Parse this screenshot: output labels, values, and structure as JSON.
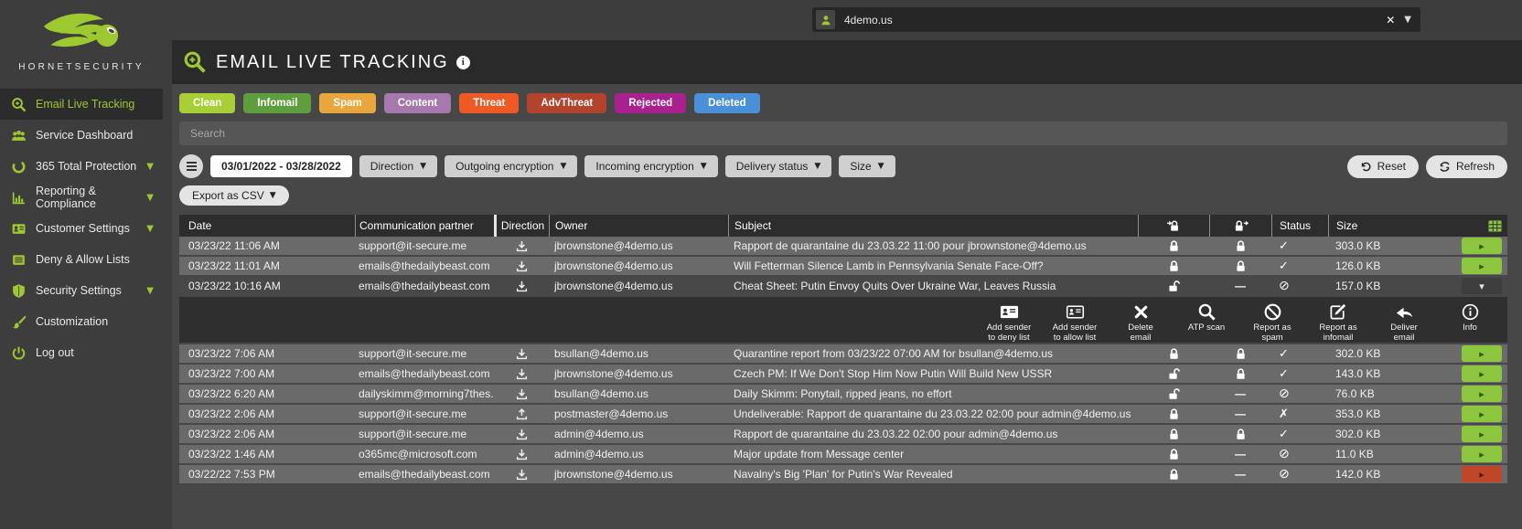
{
  "brand": {
    "name": "HORNETSECURITY"
  },
  "topbar": {
    "account": "4demo.us"
  },
  "header": {
    "title": "EMAIL LIVE TRACKING"
  },
  "sidebar": {
    "items": [
      {
        "label": "Email Live Tracking",
        "active": true
      },
      {
        "label": "Service Dashboard"
      },
      {
        "label": "365 Total Protection",
        "expandable": true
      },
      {
        "label": "Reporting & Compliance",
        "expandable": true
      },
      {
        "label": "Customer Settings",
        "expandable": true
      },
      {
        "label": "Deny & Allow Lists"
      },
      {
        "label": "Security Settings",
        "expandable": true
      },
      {
        "label": "Customization"
      },
      {
        "label": "Log out"
      }
    ]
  },
  "chips": [
    {
      "label": "Clean",
      "color": "#a8cf36"
    },
    {
      "label": "Infomail",
      "color": "#5f9e3e"
    },
    {
      "label": "Spam",
      "color": "#e9a63c"
    },
    {
      "label": "Content",
      "color": "#a678ad"
    },
    {
      "label": "Threat",
      "color": "#ef5a24"
    },
    {
      "label": "AdvThreat",
      "color": "#b2432c"
    },
    {
      "label": "Rejected",
      "color": "#a9218e"
    },
    {
      "label": "Deleted",
      "color": "#4a90d9"
    }
  ],
  "search": {
    "placeholder": "Search"
  },
  "toolbar": {
    "date_range": "03/01/2022 - 03/28/2022",
    "dropdowns": [
      "Direction",
      "Outgoing encryption",
      "Incoming encryption",
      "Delivery status",
      "Size"
    ],
    "reset": "Reset",
    "refresh": "Refresh",
    "export": "Export as CSV"
  },
  "table": {
    "columns": {
      "date": "Date",
      "partner": "Communication partner",
      "direction": "Direction",
      "owner": "Owner",
      "subject": "Subject",
      "status": "Status",
      "size": "Size"
    },
    "rows": [
      {
        "date": "03/23/22 11:06 AM",
        "partner": "support@it-secure.me",
        "direction": "in",
        "owner": "jbrownstone@4demo.us",
        "subject": "Rapport de quarantaine du 23.03.22 11:00 pour jbrownstone@4demo.us",
        "out_enc": "locked",
        "in_enc": "locked",
        "status": "ok",
        "size": "303.0 KB",
        "action": "green",
        "state": "normal"
      },
      {
        "date": "03/23/22 11:01 AM",
        "partner": "emails@thedailybeast.com",
        "direction": "in",
        "owner": "jbrownstone@4demo.us",
        "subject": "Will Fetterman Silence Lamb in Pennsylvania Senate Face-Off?",
        "out_enc": "locked",
        "in_enc": "locked",
        "status": "ok",
        "size": "126.0 KB",
        "action": "green",
        "state": "normal"
      },
      {
        "date": "03/23/22 10:16 AM",
        "partner": "emails@thedailybeast.com",
        "direction": "in",
        "owner": "jbrownstone@4demo.us",
        "subject": "Cheat Sheet: Putin Envoy Quits Over Ukraine War, Leaves Russia",
        "out_enc": "unlocked",
        "in_enc": "none",
        "status": "blocked",
        "size": "157.0 KB",
        "action": "expanded",
        "state": "selected"
      },
      {
        "date": "03/23/22 7:06 AM",
        "partner": "support@it-secure.me",
        "direction": "in",
        "owner": "bsullan@4demo.us",
        "subject": "Quarantine report from 03/23/22 07:00 AM for bsullan@4demo.us",
        "out_enc": "locked",
        "in_enc": "locked",
        "status": "ok",
        "size": "302.0 KB",
        "action": "green",
        "state": "normal"
      },
      {
        "date": "03/23/22 7:00 AM",
        "partner": "emails@thedailybeast.com",
        "direction": "in",
        "owner": "jbrownstone@4demo.us",
        "subject": "Czech PM: If We Don't Stop Him Now Putin Will Build New USSR",
        "out_enc": "unlocked",
        "in_enc": "locked",
        "status": "ok",
        "size": "143.0 KB",
        "action": "green",
        "state": "normal"
      },
      {
        "date": "03/23/22 6:20 AM",
        "partner": "dailyskimm@morning7thes...",
        "direction": "in",
        "owner": "bsullan@4demo.us",
        "subject": "Daily Skimm: Ponytail, ripped jeans, no effort",
        "out_enc": "unlocked",
        "in_enc": "none",
        "status": "blocked",
        "size": "76.0 KB",
        "action": "green",
        "state": "normal"
      },
      {
        "date": "03/23/22 2:06 AM",
        "partner": "support@it-secure.me",
        "direction": "out",
        "owner": "postmaster@4demo.us",
        "subject": "Undeliverable: Rapport de quarantaine du 23.03.22 02:00 pour admin@4demo.us",
        "out_enc": "locked",
        "in_enc": "none",
        "status": "fail",
        "size": "353.0 KB",
        "action": "green",
        "state": "normal"
      },
      {
        "date": "03/23/22 2:06 AM",
        "partner": "support@it-secure.me",
        "direction": "in",
        "owner": "admin@4demo.us",
        "subject": "Rapport de quarantaine du 23.03.22 02:00 pour admin@4demo.us",
        "out_enc": "locked",
        "in_enc": "locked",
        "status": "ok",
        "size": "302.0 KB",
        "action": "green",
        "state": "normal"
      },
      {
        "date": "03/23/22 1:46 AM",
        "partner": "o365mc@microsoft.com",
        "direction": "in",
        "owner": "admin@4demo.us",
        "subject": "Major update from Message center",
        "out_enc": "locked",
        "in_enc": "none",
        "status": "blocked",
        "size": "11.0 KB",
        "action": "green",
        "state": "normal"
      },
      {
        "date": "03/22/22 7:53 PM",
        "partner": "emails@thedailybeast.com",
        "direction": "in",
        "owner": "jbrownstone@4demo.us",
        "subject": "Navalny's Big 'Plan' for Putin's War Revealed",
        "out_enc": "locked",
        "in_enc": "none",
        "status": "blocked",
        "size": "142.0 KB",
        "action": "red",
        "state": "normal"
      }
    ]
  },
  "actions": [
    {
      "line1": "Add sender",
      "line2": "to deny list"
    },
    {
      "line1": "Add sender",
      "line2": "to allow list"
    },
    {
      "line1": "Delete",
      "line2": "email"
    },
    {
      "line1": "ATP scan",
      "line2": ""
    },
    {
      "line1": "Report as",
      "line2": "spam"
    },
    {
      "line1": "Report as",
      "line2": "infomail"
    },
    {
      "line1": "Deliver",
      "line2": "email"
    },
    {
      "line1": "Info",
      "line2": ""
    }
  ]
}
